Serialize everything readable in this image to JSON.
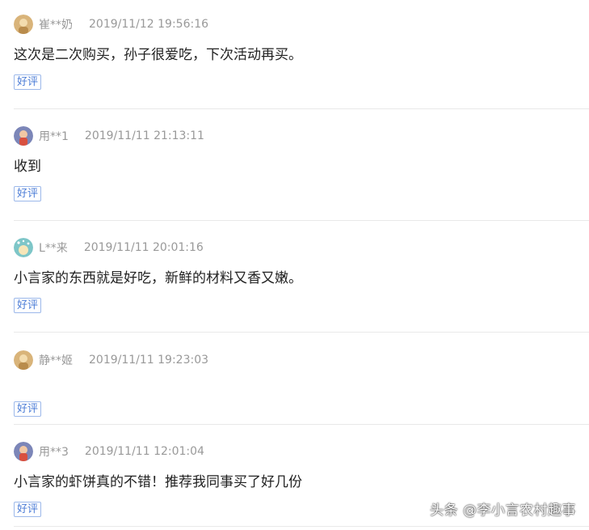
{
  "reviews": [
    {
      "username": "崔**奶",
      "timestamp": "2019/11/12 19:56:16",
      "text": "这次是二次购买，孙子很爱吃，下次活动再买。",
      "tag": "好评",
      "avatar_color": "#d9b47a"
    },
    {
      "username": "用**1",
      "timestamp": "2019/11/11 21:13:11",
      "text": "收到",
      "tag": "好评",
      "avatar_color": "#7c86b8"
    },
    {
      "username": "L**来",
      "timestamp": "2019/11/11 20:01:16",
      "text": "小言家的东西就是好吃，新鲜的材料又香又嫩。",
      "tag": "好评",
      "avatar_color": "#7ec6c8"
    },
    {
      "username": "静**姬",
      "timestamp": "2019/11/11 19:23:03",
      "text": "",
      "tag": "好评",
      "avatar_color": "#d9b47a"
    },
    {
      "username": "用**3",
      "timestamp": "2019/11/11 12:01:04",
      "text": "小言家的虾饼真的不错！推荐我同事买了好几份",
      "tag": "好评",
      "avatar_color": "#7c86b8"
    }
  ],
  "watermark": "头条 @李小言农村趣事"
}
